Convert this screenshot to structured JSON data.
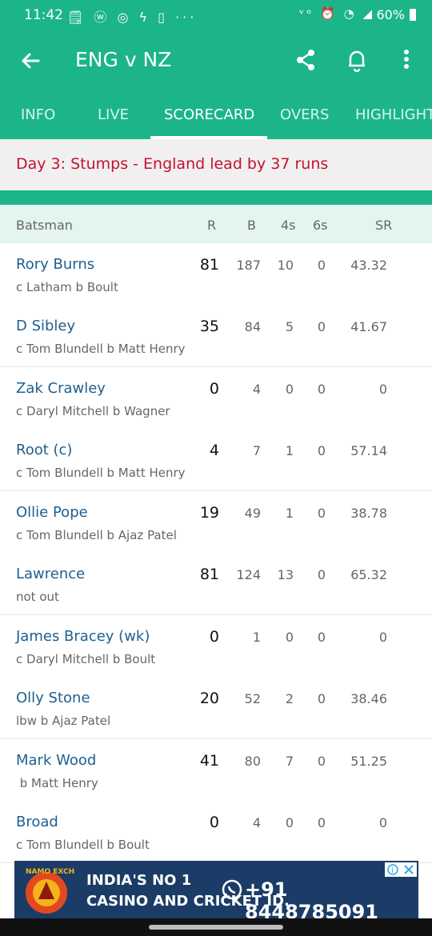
{
  "status_bar": {
    "time": "11:42",
    "notification_icons": "🗒 ⓦ ◎ ϟ ▯ ···",
    "system_icons": "ᵛᵒ ⏰ ◔ ◢",
    "battery": "60%"
  },
  "app_bar": {
    "title": "ENG v NZ"
  },
  "tabs": [
    "INFO",
    "LIVE",
    "SCORECARD",
    "OVERS",
    "HIGHLIGHTS"
  ],
  "active_tab": "SCORECARD",
  "match_status": "Day 3: Stumps - England lead by 37 runs",
  "table_header": {
    "batsman": "Batsman",
    "runs": "R",
    "balls": "B",
    "fours": "4s",
    "sixes": "6s",
    "strike_rate": "SR"
  },
  "batsmen": [
    {
      "name": "Rory Burns",
      "dismissal": "c Latham b Boult",
      "runs": "81",
      "balls": "187",
      "fours": "10",
      "sixes": "0",
      "sr": "43.32"
    },
    {
      "name": "D Sibley",
      "dismissal": "c Tom Blundell b Matt Henry",
      "runs": "35",
      "balls": "84",
      "fours": "5",
      "sixes": "0",
      "sr": "41.67"
    },
    {
      "name": "Zak Crawley",
      "dismissal": "c Daryl Mitchell b Wagner",
      "runs": "0",
      "balls": "4",
      "fours": "0",
      "sixes": "0",
      "sr": "0"
    },
    {
      "name": "Root (c)",
      "dismissal": "c Tom Blundell b Matt Henry",
      "runs": "4",
      "balls": "7",
      "fours": "1",
      "sixes": "0",
      "sr": "57.14"
    },
    {
      "name": "Ollie Pope",
      "dismissal": "c Tom Blundell b Ajaz Patel",
      "runs": "19",
      "balls": "49",
      "fours": "1",
      "sixes": "0",
      "sr": "38.78"
    },
    {
      "name": "Lawrence",
      "dismissal": "not out",
      "runs": "81",
      "balls": "124",
      "fours": "13",
      "sixes": "0",
      "sr": "65.32"
    },
    {
      "name": "James Bracey (wk)",
      "dismissal": "c Daryl Mitchell b Boult",
      "runs": "0",
      "balls": "1",
      "fours": "0",
      "sixes": "0",
      "sr": "0"
    },
    {
      "name": "Olly Stone",
      "dismissal": "lbw b Ajaz Patel",
      "runs": "20",
      "balls": "52",
      "fours": "2",
      "sixes": "0",
      "sr": "38.46"
    },
    {
      "name": "Mark Wood",
      "dismissal": " b Matt Henry",
      "runs": "41",
      "balls": "80",
      "fours": "7",
      "sixes": "0",
      "sr": "51.25"
    },
    {
      "name": "Broad",
      "dismissal": "c Tom Blundell b Boult",
      "runs": "0",
      "balls": "4",
      "fours": "0",
      "sixes": "0",
      "sr": "0"
    }
  ],
  "ad": {
    "brand": "NAMO EXCH",
    "line1": "INDIA'S NO 1",
    "line2": "CASINO AND CRICKET ID.",
    "phone": "+91 8448785091"
  },
  "colors": {
    "primary": "#1bb589",
    "status_red": "#c8102e",
    "name_blue": "#1e5f8f"
  }
}
